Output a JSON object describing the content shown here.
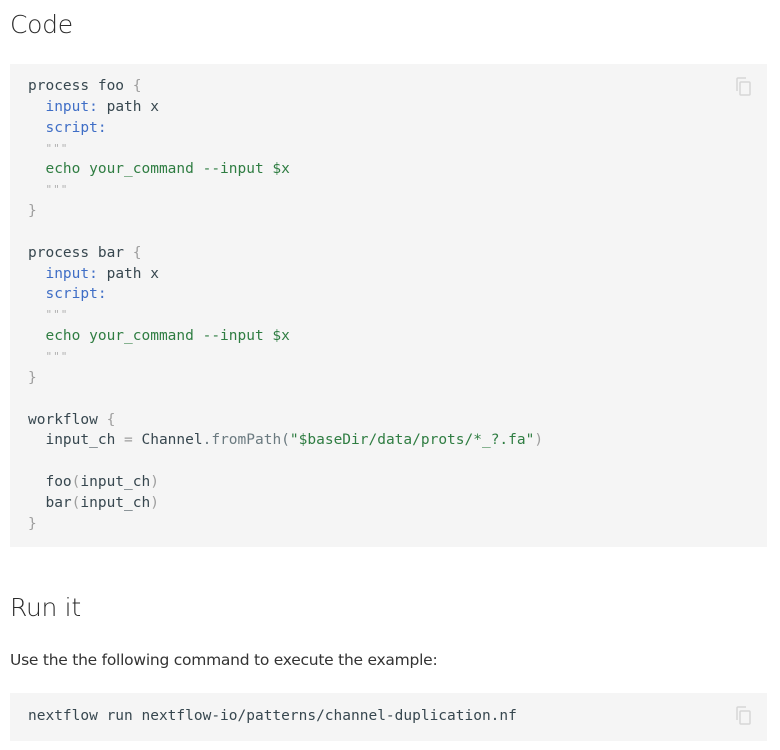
{
  "sections": {
    "code_heading": "Code",
    "run_heading": "Run it",
    "run_description": "Use the the following command to execute the example:"
  },
  "code_block": {
    "lines": [
      {
        "parts": [
          {
            "t": "process foo ",
            "c": "kw"
          },
          {
            "t": "{",
            "c": "punc"
          }
        ]
      },
      {
        "parts": [
          {
            "t": "  ",
            "c": "kw"
          },
          {
            "t": "input:",
            "c": "key"
          },
          {
            "t": " path x",
            "c": "kw"
          }
        ]
      },
      {
        "parts": [
          {
            "t": "  ",
            "c": "kw"
          },
          {
            "t": "script:",
            "c": "key"
          }
        ]
      },
      {
        "parts": [
          {
            "t": "  ",
            "c": "kw"
          },
          {
            "t": "\"\"\"",
            "c": "dq"
          }
        ]
      },
      {
        "parts": [
          {
            "t": "  echo your_command --input $x",
            "c": "str"
          }
        ]
      },
      {
        "parts": [
          {
            "t": "  ",
            "c": "kw"
          },
          {
            "t": "\"\"\"",
            "c": "dq"
          }
        ]
      },
      {
        "parts": [
          {
            "t": "}",
            "c": "punc"
          }
        ]
      },
      {
        "parts": [
          {
            "t": "",
            "c": "kw"
          }
        ]
      },
      {
        "parts": [
          {
            "t": "process bar ",
            "c": "kw"
          },
          {
            "t": "{",
            "c": "punc"
          }
        ]
      },
      {
        "parts": [
          {
            "t": "  ",
            "c": "kw"
          },
          {
            "t": "input:",
            "c": "key"
          },
          {
            "t": " path x",
            "c": "kw"
          }
        ]
      },
      {
        "parts": [
          {
            "t": "  ",
            "c": "kw"
          },
          {
            "t": "script:",
            "c": "key"
          }
        ]
      },
      {
        "parts": [
          {
            "t": "  ",
            "c": "kw"
          },
          {
            "t": "\"\"\"",
            "c": "dq"
          }
        ]
      },
      {
        "parts": [
          {
            "t": "  echo your_command --input $x",
            "c": "str"
          }
        ]
      },
      {
        "parts": [
          {
            "t": "  ",
            "c": "kw"
          },
          {
            "t": "\"\"\"",
            "c": "dq"
          }
        ]
      },
      {
        "parts": [
          {
            "t": "}",
            "c": "punc"
          }
        ]
      },
      {
        "parts": [
          {
            "t": "",
            "c": "kw"
          }
        ]
      },
      {
        "parts": [
          {
            "t": "workflow ",
            "c": "kw"
          },
          {
            "t": "{",
            "c": "punc"
          }
        ]
      },
      {
        "parts": [
          {
            "t": "  input_ch ",
            "c": "kw"
          },
          {
            "t": "=",
            "c": "op"
          },
          {
            "t": " Channel",
            "c": "kw"
          },
          {
            "t": ".fromPath(",
            "c": "method"
          },
          {
            "t": "\"$baseDir/data/prots/*_?.fa\"",
            "c": "str"
          },
          {
            "t": ")",
            "c": "punc"
          }
        ]
      },
      {
        "parts": [
          {
            "t": "",
            "c": "kw"
          }
        ]
      },
      {
        "parts": [
          {
            "t": "  foo",
            "c": "kw"
          },
          {
            "t": "(",
            "c": "punc"
          },
          {
            "t": "input_ch",
            "c": "kw"
          },
          {
            "t": ")",
            "c": "punc"
          }
        ]
      },
      {
        "parts": [
          {
            "t": "  bar",
            "c": "kw"
          },
          {
            "t": "(",
            "c": "punc"
          },
          {
            "t": "input_ch",
            "c": "kw"
          },
          {
            "t": ")",
            "c": "punc"
          }
        ]
      },
      {
        "parts": [
          {
            "t": "}",
            "c": "punc"
          }
        ]
      }
    ],
    "copy_icon": "copy-icon"
  },
  "command_block": {
    "command": "nextflow run nextflow-io/patterns/channel-duplication.nf",
    "copy_icon": "copy-icon"
  },
  "colors": {
    "code_background": "#f5f5f5",
    "keyword_blue": "#3f6ec6",
    "string_green": "#2f7d42",
    "punctuation_gray": "#9e9e9e"
  }
}
